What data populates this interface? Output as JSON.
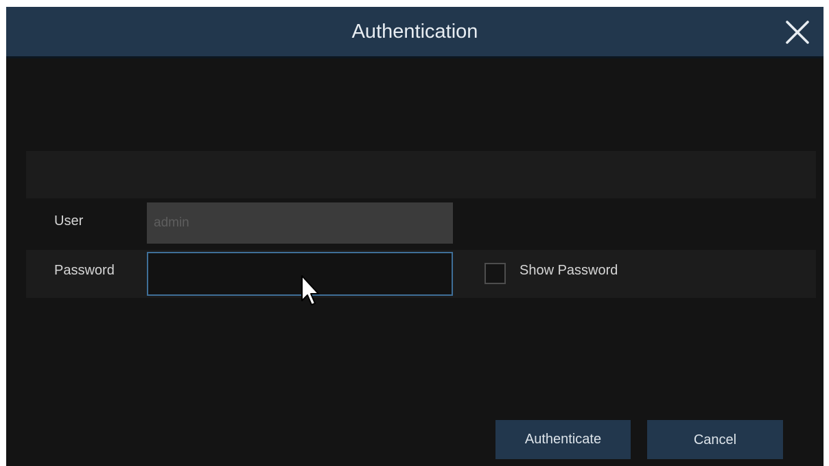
{
  "dialog": {
    "title": "Authentication",
    "close_icon": "close-icon"
  },
  "form": {
    "user_label": "User",
    "user_value": "admin",
    "password_label": "Password",
    "password_value": "",
    "show_password_label": "Show Password",
    "show_password_checked": false
  },
  "buttons": {
    "authenticate_label": "Authenticate",
    "cancel_label": "Cancel"
  },
  "colors": {
    "titlebar": "#22374d",
    "background": "#141414",
    "focus_border": "#3f6f98"
  }
}
